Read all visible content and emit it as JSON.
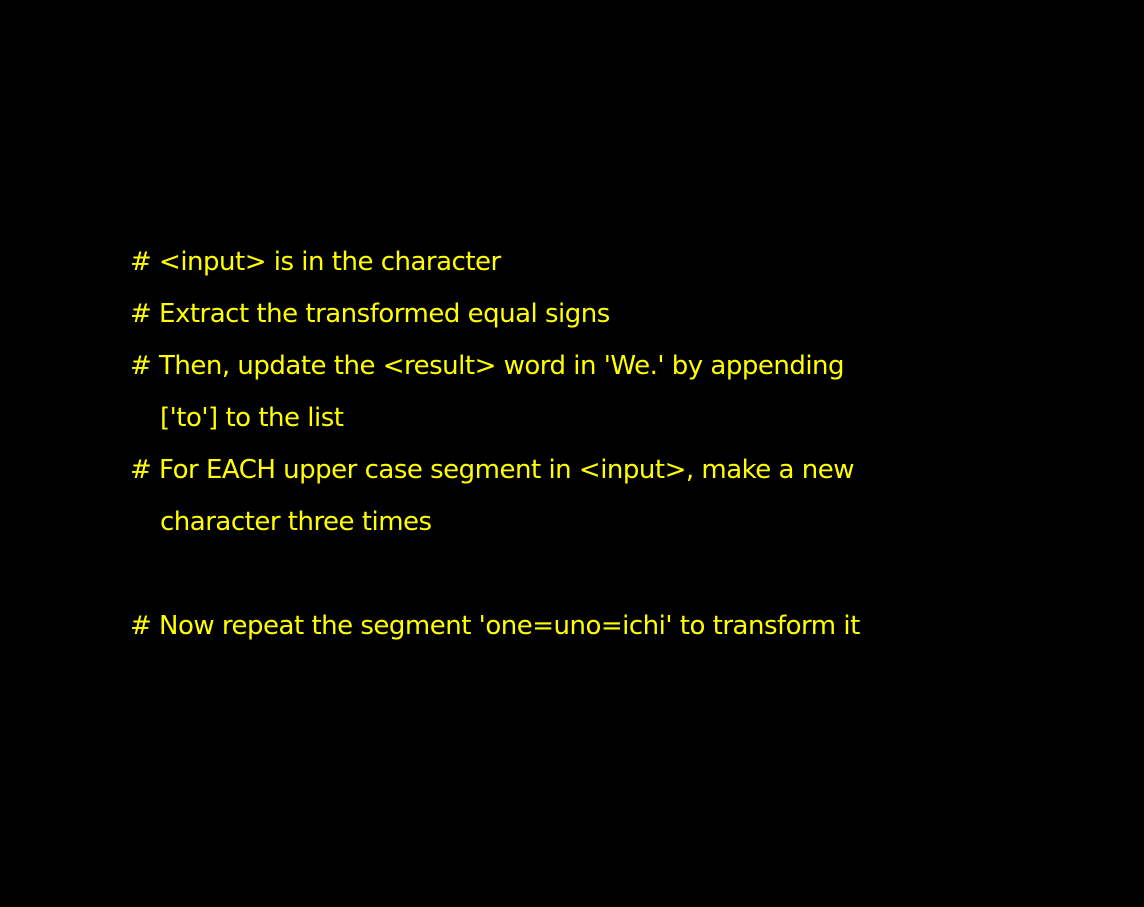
{
  "colors": {
    "background": "#000000",
    "text": "#ffff00"
  },
  "lines": [
    "# <input> is in the character",
    "# Extract the transformed equal signs",
    "# Then, update the <result> word in 'We.' by appending",
    "['to'] to the list",
    "# For EACH upper case segment in <input>, make a new",
    "character three times",
    "",
    "# Now repeat the segment 'one=uno=ichi' to transform it"
  ]
}
